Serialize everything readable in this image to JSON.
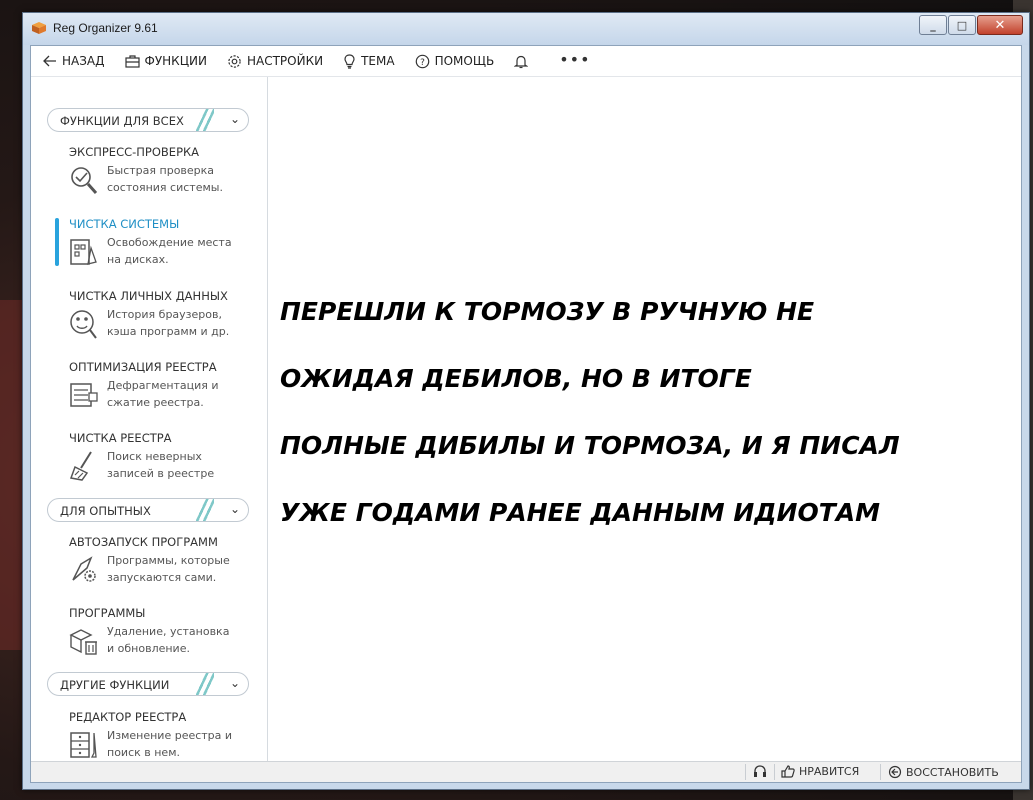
{
  "window": {
    "title": "Reg Organizer 9.61"
  },
  "toolbar": {
    "back_label": "НАЗАД",
    "functions_label": "ФУНКЦИИ",
    "settings_label": "НАСТРОЙКИ",
    "theme_label": "ТЕМА",
    "help_label": "ПОМОЩЬ",
    "more_label": "•••"
  },
  "sidebar": {
    "sections": [
      {
        "label": "ФУНКЦИИ ДЛЯ ВСЕХ",
        "items": [
          {
            "title": "ЭКСПРЕСС-ПРОВЕРКА",
            "desc1": "Быстрая проверка",
            "desc2": "состояния системы."
          },
          {
            "title": "ЧИСТКА СИСТЕМЫ",
            "desc1": "Освобождение места",
            "desc2": "на дисках.",
            "active": true
          },
          {
            "title": "ЧИСТКА ЛИЧНЫХ ДАННЫХ",
            "desc1": "История браузеров,",
            "desc2": "кэша программ и др."
          },
          {
            "title": "ОПТИМИЗАЦИЯ РЕЕСТРА",
            "desc1": "Дефрагментация и",
            "desc2": "сжатие реестра."
          },
          {
            "title": "ЧИСТКА РЕЕСТРА",
            "desc1": "Поиск неверных",
            "desc2": "записей в реестре"
          }
        ]
      },
      {
        "label": "ДЛЯ ОПЫТНЫХ",
        "items": [
          {
            "title": "АВТОЗАПУСК ПРОГРАММ",
            "desc1": "Программы, которые",
            "desc2": "запускаются сами."
          },
          {
            "title": "ПРОГРАММЫ",
            "desc1": "Удаление, установка",
            "desc2": "и обновление."
          }
        ]
      },
      {
        "label": "ДРУГИЕ ФУНКЦИИ",
        "items": [
          {
            "title": "РЕДАКТОР РЕЕСТРА",
            "desc1": "Изменение реестра и",
            "desc2": "поиск в нем."
          }
        ]
      }
    ]
  },
  "content": {
    "message_lines": [
      "ПЕРЕШЛИ К ТОРМОЗУ В РУЧНУЮ НЕ",
      "ОЖИДАЯ ДЕБИЛОВ, НО В ИТОГЕ",
      "ПОЛНЫЕ ДИБИЛЫ И ТОРМОЗА, И Я ПИСАЛ",
      "УЖЕ ГОДАМИ РАНЕЕ ДАННЫМ ИДИОТАМ"
    ]
  },
  "statusbar": {
    "like_label": "НРАВИТСЯ",
    "restore_label": "ВОССТАНОВИТЬ"
  },
  "colors": {
    "accent": "#29a3dd",
    "active_text": "#1f8fc5"
  }
}
